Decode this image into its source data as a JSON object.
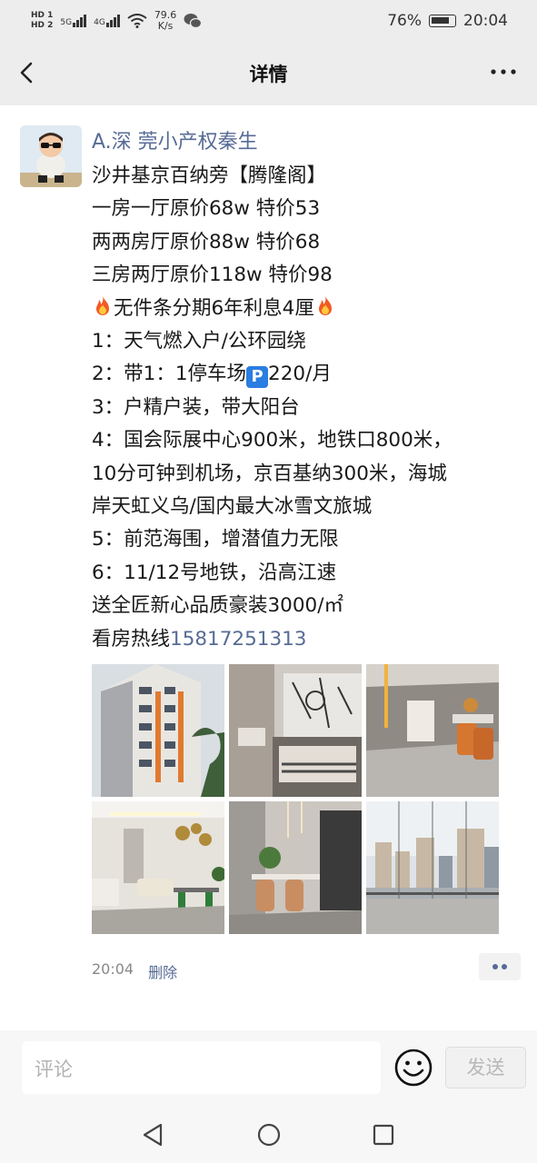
{
  "status_bar": {
    "hd1": "HD 1",
    "hd2": "HD 2",
    "net1": "5G",
    "net2": "4G",
    "speed_value": "79.6",
    "speed_unit": "K/s",
    "battery": "76%",
    "time": "20:04"
  },
  "nav": {
    "back_icon": "back-arrow-icon",
    "title": "详情",
    "more_icon": "more-icon"
  },
  "post": {
    "author": "A.深 莞小产权秦生",
    "lines": {
      "l1": "沙井基京百纳旁【腾隆阁】",
      "l2": "一房一厅原价68w  特价53",
      "l3": "两两房厅原价88w  特价68",
      "l4": "三房两厅原价118w 特价98",
      "l5": "无件条分期6年利息4厘",
      "l6": "1：天气燃入户/公环园绕",
      "l7a": "2：带1：1停车场",
      "l7b": "220/月",
      "l8": "3：户精户装，带大阳台",
      "l9": "4：国会际展中心900米，地铁口800米，",
      "l10": "10分可钟到机场，京百基纳300米，海城",
      "l11": "岸天虹义乌/国内最大冰雪文旅城",
      "l12": "5：前范海围，增潜值力无限",
      "l13": "6：11/12号地铁，沿高江速",
      "l14": "送全匠新心品质豪装3000/㎡",
      "l15a": "看房热线",
      "l15b": "15817251313"
    },
    "parking_icon_text": "P",
    "images": [
      "building-exterior",
      "bedroom",
      "living-hall",
      "living-room",
      "dining-area",
      "balcony-view"
    ],
    "time": "20:04",
    "delete": "删除"
  },
  "input": {
    "placeholder": "评论",
    "emoji_icon": "smile-icon",
    "send": "发送"
  },
  "colors": {
    "link": "#576b95",
    "background": "#ededed",
    "card": "#ffffff"
  }
}
